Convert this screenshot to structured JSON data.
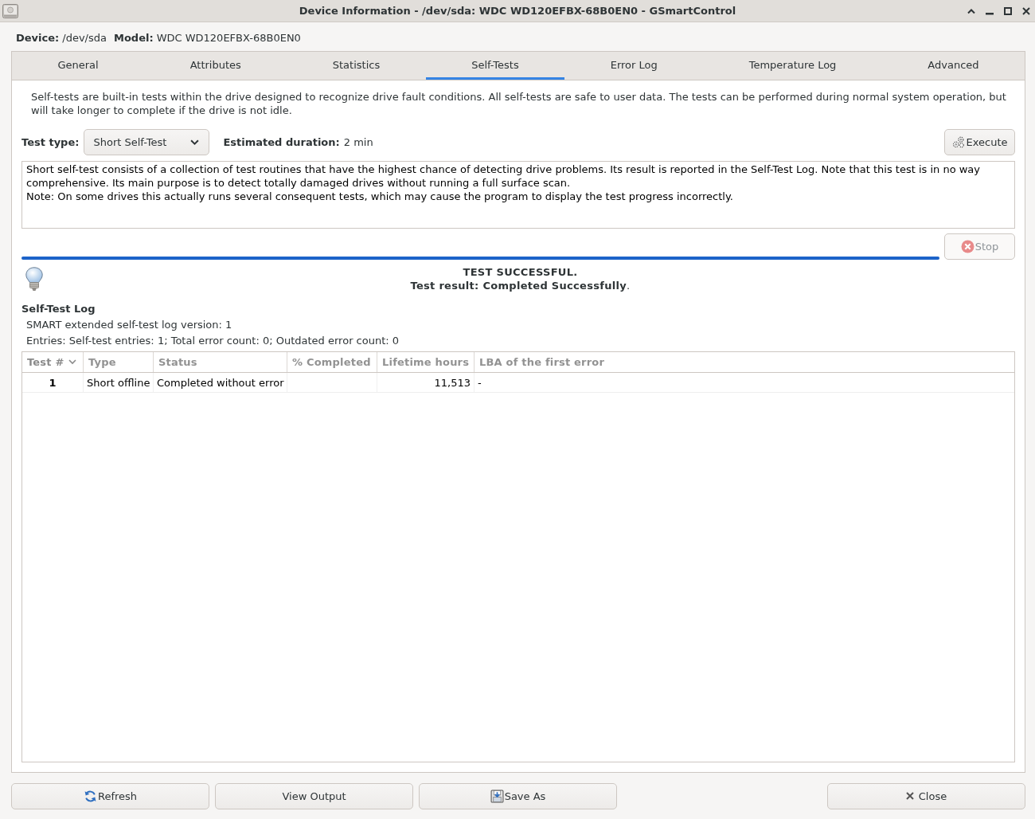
{
  "window": {
    "title": "Device Information - /dev/sda: WDC WD120EFBX-68B0EN0 - GSmartControl"
  },
  "device_info": {
    "device_label": "Device:",
    "device_value": "/dev/sda",
    "model_label": "Model:",
    "model_value": "WDC WD120EFBX-68B0EN0"
  },
  "tabs": [
    {
      "label": "General",
      "selected": false
    },
    {
      "label": "Attributes",
      "selected": false
    },
    {
      "label": "Statistics",
      "selected": false
    },
    {
      "label": "Self-Tests",
      "selected": true
    },
    {
      "label": "Error Log",
      "selected": false
    },
    {
      "label": "Temperature Log",
      "selected": false
    },
    {
      "label": "Advanced",
      "selected": false
    }
  ],
  "intro": "Self-tests are built-in tests within the drive designed to recognize drive fault conditions. All self-tests are safe to user data. The tests can be performed during normal system operation, but will take longer to complete if the drive is not idle.",
  "test_type": {
    "label": "Test type:",
    "value": "Short Self-Test"
  },
  "estimated_duration": {
    "label": "Estimated duration:",
    "value": "2 min"
  },
  "execute_button": {
    "label": "Execute",
    "disabled": false
  },
  "description": [
    "Short self-test consists of a collection of test routines that have the highest chance of detecting drive problems. Its result is reported in the Self-Test Log. Note that this test is in no way comprehensive. Its main purpose is to detect totally damaged drives without running a full surface scan.",
    "Note: On some drives this actually runs several consequent tests, which may cause the program to display the test progress incorrectly."
  ],
  "progress": {
    "level": 1
  },
  "stop_button": {
    "label": "Stop",
    "disabled": true
  },
  "result": {
    "headline": "TEST SUCCESSFUL.",
    "detail": "**Test result: Completed Successfully**."
  },
  "log": {
    "title": "Self-Test Log",
    "version": "SMART extended self-test log version: 1",
    "entries": "Entries: Self-test entries: 1; Total error count: 0; Outdated error count: 0"
  },
  "table": {
    "columns": [
      {
        "label": "Test #",
        "sorted": true
      },
      {
        "label": "Type",
        "sorted": false
      },
      {
        "label": "Status",
        "sorted": false
      },
      {
        "label": "% Completed",
        "sorted": false
      },
      {
        "label": "Lifetime hours",
        "sorted": false
      },
      {
        "label": "LBA of the first error",
        "sorted": false
      }
    ],
    "rows": [
      {
        "test_number": "1",
        "type": "Short offline",
        "status": "Completed without error",
        "lifetime_hours": "11,513",
        "lba_of_first_error": "-"
      }
    ]
  },
  "buttons": [
    {
      "label": "Refresh",
      "kind": "refresh"
    },
    {
      "label": "View Output",
      "kind": "plain"
    },
    {
      "label": "Save As",
      "kind": "save"
    },
    {
      "label": "Close",
      "kind": "close"
    }
  ]
}
